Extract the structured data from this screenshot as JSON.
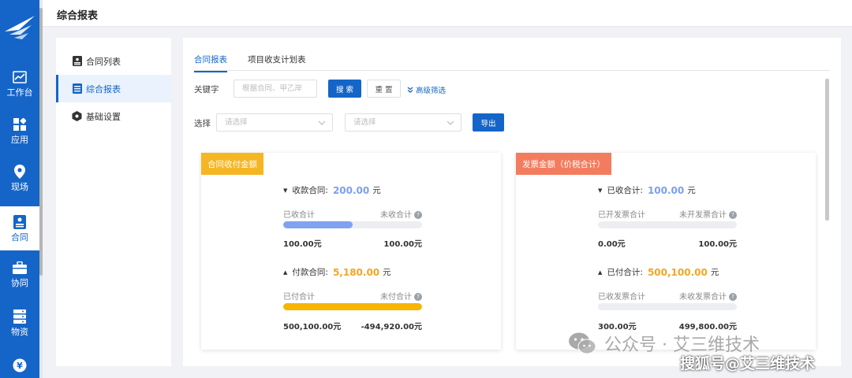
{
  "colors": {
    "brand": "#1565c8",
    "orange": "#f5a623",
    "salmon": "#f47c5e",
    "blue_fill": "#7fa3f0",
    "yellow_fill": "#f7b500"
  },
  "nav": {
    "items": [
      {
        "label": "工作台",
        "icon": "trend-chart-icon"
      },
      {
        "label": "应用",
        "icon": "apps-grid-icon"
      },
      {
        "label": "现场",
        "icon": "location-pin-icon"
      },
      {
        "label": "合同",
        "icon": "contract-icon"
      },
      {
        "label": "协同",
        "icon": "briefcase-icon"
      },
      {
        "label": "物资",
        "icon": "storage-icon"
      },
      {
        "label": "",
        "icon": "yen-icon"
      }
    ]
  },
  "header": {
    "title": "综合报表"
  },
  "submenu": {
    "items": [
      {
        "label": "合同列表"
      },
      {
        "label": "综合报表"
      },
      {
        "label": "基础设置"
      }
    ]
  },
  "tabs": [
    {
      "label": "合同报表"
    },
    {
      "label": "项目收支计划表"
    }
  ],
  "filters": {
    "keyword_label": "关键字",
    "keyword_placeholder": "根据合同、甲乙岸",
    "search_label": "搜 索",
    "reset_label": "重 置",
    "advanced_label": "高级筛选",
    "select_label": "选择",
    "select1_placeholder": "请选择",
    "select2_placeholder": "请选择",
    "export_label": "导出"
  },
  "card_left": {
    "tag": "合同收付金额",
    "receive": {
      "title": "收款合同:",
      "amount": "200.00",
      "unit": "元",
      "done_label": "已收合计",
      "pending_label": "未收合计",
      "done_value": "100.00元",
      "pending_value": "100.00元",
      "progress": 0.5
    },
    "pay": {
      "title": "付款合同:",
      "amount": "5,180.00",
      "unit": "元",
      "done_label": "已付合计",
      "pending_label": "未付合计",
      "done_value": "500,100.00元",
      "pending_value": "-494,920.00元",
      "progress": 1.0
    }
  },
  "card_right": {
    "tag": "发票金额（价税合计）",
    "receive": {
      "title": "已收合计:",
      "amount": "100.00",
      "unit": "元",
      "done_label": "已开发票合计",
      "pending_label": "未开发票合计",
      "done_value": "0.00元",
      "pending_value": "100.00元",
      "progress": 0.0
    },
    "pay": {
      "title": "已付合计:",
      "amount": "500,100.00",
      "unit": "元",
      "done_label": "已收发票合计",
      "pending_label": "未收发票合计",
      "done_value": "300.00元",
      "pending_value": "499,800.00元",
      "progress": 0.0
    }
  },
  "watermark": {
    "line1": "公众号 · 艾三维技术",
    "line2": "搜狐号@艾三维技术"
  }
}
